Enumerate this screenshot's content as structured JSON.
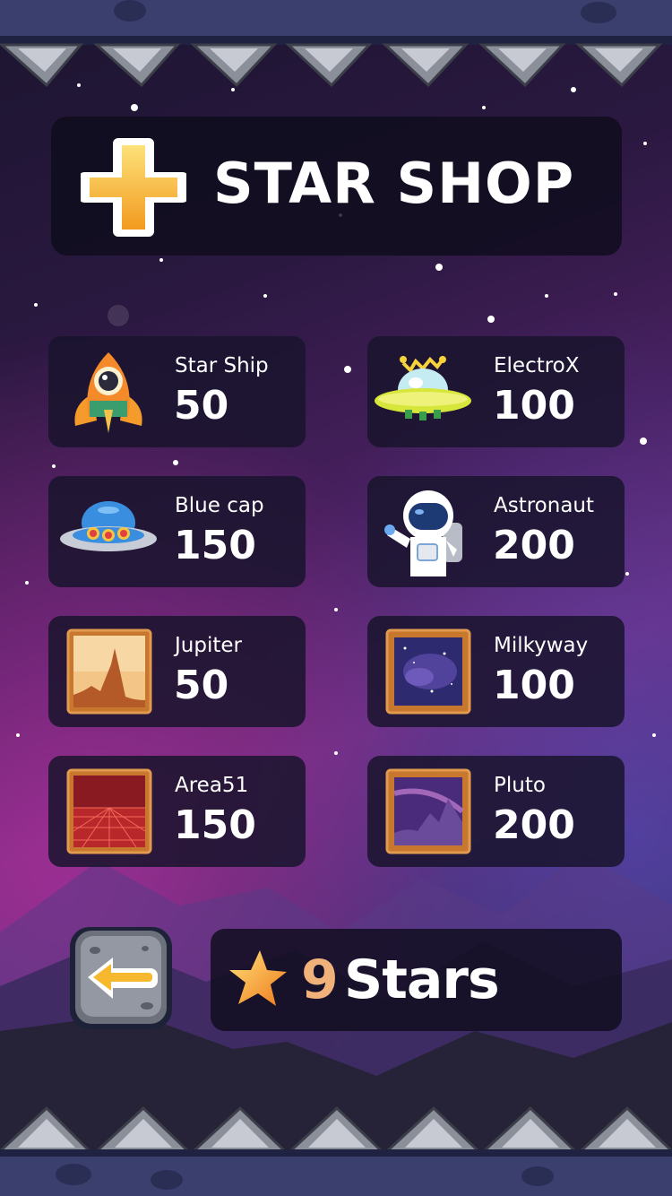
{
  "shop": {
    "title": "STAR SHOP",
    "title_icon": "plus-icon",
    "accent_color": "#f5b82e"
  },
  "items": [
    {
      "name": "Star Ship",
      "price": "50",
      "icon": "rocket-icon"
    },
    {
      "name": "ElectroX",
      "price": "100",
      "icon": "ufo-antenna-icon"
    },
    {
      "name": "Blue cap",
      "price": "150",
      "icon": "blue-ufo-icon"
    },
    {
      "name": "Astronaut",
      "price": "200",
      "icon": "astronaut-icon"
    },
    {
      "name": "Jupiter",
      "price": "50",
      "icon": "jupiter-background-icon"
    },
    {
      "name": "Milkyway",
      "price": "100",
      "icon": "milkyway-background-icon"
    },
    {
      "name": "Area51",
      "price": "150",
      "icon": "area51-background-icon"
    },
    {
      "name": "Pluto",
      "price": "200",
      "icon": "pluto-background-icon"
    }
  ],
  "footer": {
    "back_icon": "back-arrow-icon",
    "stars_count": "9",
    "stars_label": "Stars",
    "star_icon": "star-icon"
  }
}
